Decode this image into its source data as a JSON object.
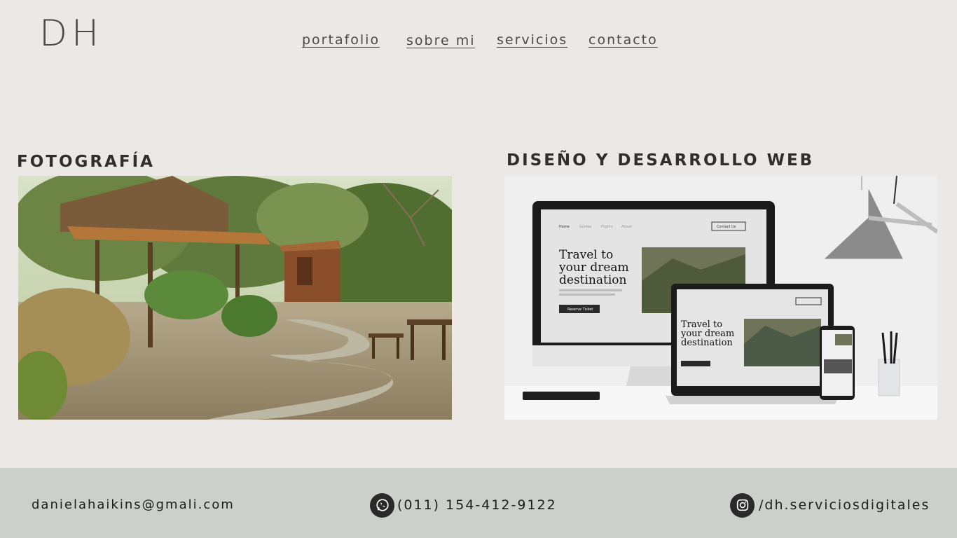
{
  "header": {
    "logo": "DH",
    "nav": [
      {
        "label": "portafolio"
      },
      {
        "label": "sobre mi"
      },
      {
        "label": "servicios"
      },
      {
        "label": "contacto"
      }
    ]
  },
  "sections": {
    "photography": {
      "title": "FOTOGRAFÍA"
    },
    "web": {
      "title": "DISEÑO Y DESARROLLO WEB",
      "mockup": {
        "nav_home": "Home",
        "nav_items": [
          "Guides",
          "Flights",
          "About"
        ],
        "contact_button": "Contact Us",
        "headline_1": "Travel to",
        "headline_2": "your dream",
        "headline_3": "destination",
        "cta": "Reserve Ticket"
      }
    }
  },
  "footer": {
    "email": "danielahaikins@gmali.com",
    "phone": "(011) 154-412-9122",
    "instagram": "/dh.serviciosdigitales"
  },
  "colors": {
    "background": "#ebe8e5",
    "footer": "#ccd0ca",
    "text": "#2b2b2b"
  }
}
